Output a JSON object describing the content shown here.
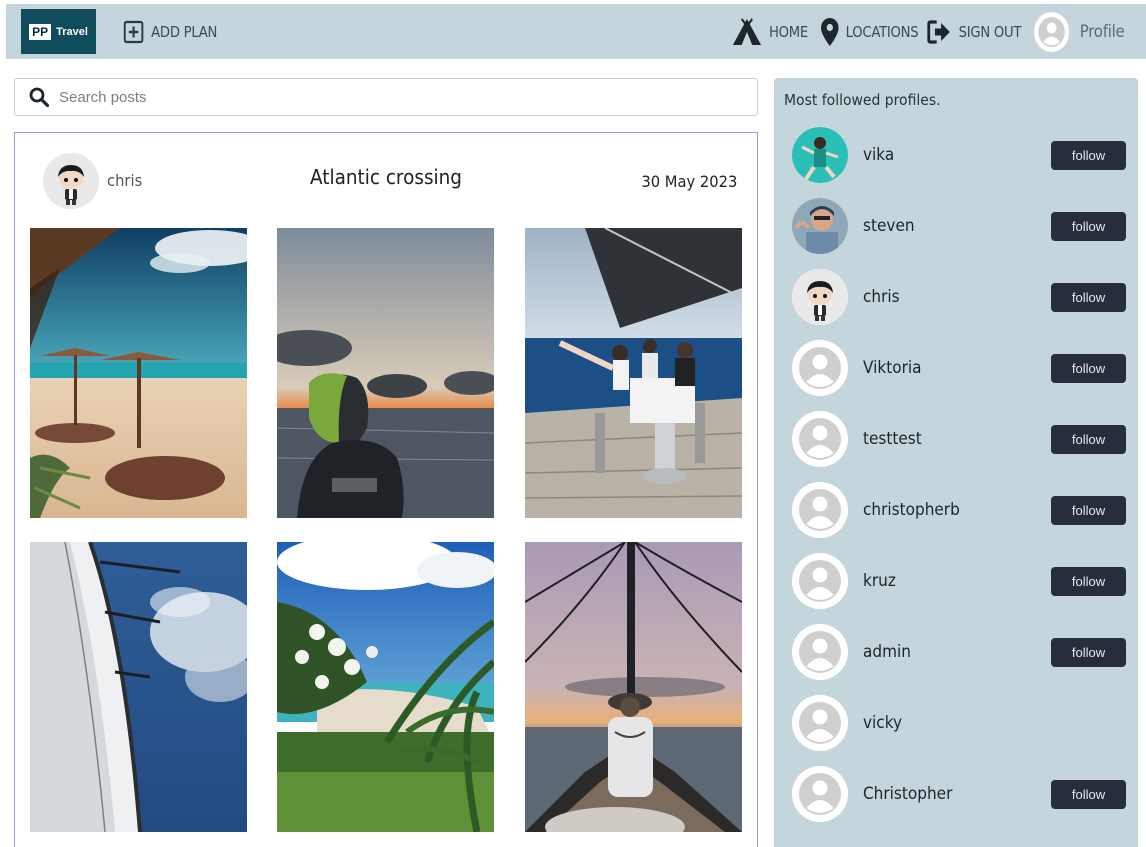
{
  "nav": {
    "logo_box": "PP",
    "logo_text": "Travel",
    "add_plan": "ADD PLAN",
    "home": "HOME",
    "locations": "LOCATIONS",
    "sign_out": "SIGN OUT",
    "profile": "Profile"
  },
  "search": {
    "placeholder": "Search posts"
  },
  "post": {
    "author": "chris",
    "title": "Atlantic crossing",
    "date": "30 May 2023"
  },
  "sidebar": {
    "title": "Most followed profiles.",
    "follow_label": "follow",
    "profiles": [
      {
        "name": "vika",
        "has_follow": true
      },
      {
        "name": "steven",
        "has_follow": true
      },
      {
        "name": "chris",
        "has_follow": true
      },
      {
        "name": "Viktoria",
        "has_follow": true
      },
      {
        "name": "testtest",
        "has_follow": true
      },
      {
        "name": "christopherb",
        "has_follow": true
      },
      {
        "name": "kruz",
        "has_follow": true
      },
      {
        "name": "admin",
        "has_follow": true
      },
      {
        "name": "vicky",
        "has_follow": false
      },
      {
        "name": "Christopher",
        "has_follow": true
      }
    ]
  },
  "colors": {
    "nav_bg": "#c5d5dc",
    "logo_bg": "#0f4c5c",
    "follow_bg": "#272d3a",
    "card_border": "#9aa0c8"
  }
}
